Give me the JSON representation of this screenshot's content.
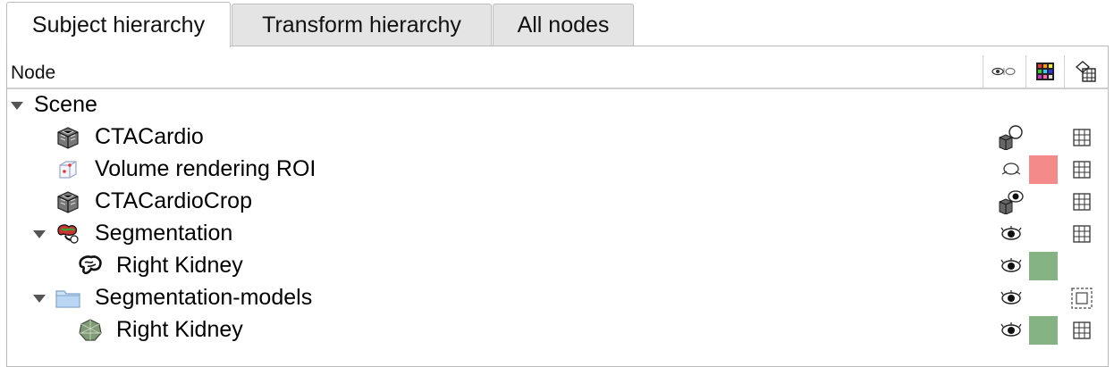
{
  "tabs": [
    {
      "label": "Subject hierarchy",
      "active": true
    },
    {
      "label": "Transform hierarchy",
      "active": false
    },
    {
      "label": "All nodes",
      "active": false
    }
  ],
  "tree": {
    "header": {
      "node": "Node",
      "columns": [
        {
          "icon": "visibility-eye-icon"
        },
        {
          "icon": "color-grid-icon"
        },
        {
          "icon": "transform-column-icon"
        }
      ]
    },
    "rows": [
      {
        "label": "Scene",
        "icon": "none",
        "expanded": true,
        "visibility": "none",
        "color": null,
        "transform": "none"
      },
      {
        "label": "CTACardio",
        "icon": "volume-cube-icon",
        "visibility": "volume-hidden-icon",
        "color": null,
        "transform": "transform-grid-icon"
      },
      {
        "label": "Volume rendering ROI",
        "icon": "roi-box-icon",
        "visibility": "eye-closed-icon",
        "color": "#f48a8a",
        "transform": "transform-grid-icon"
      },
      {
        "label": "CTACardioCrop",
        "icon": "volume-cube-icon",
        "visibility": "volume-visible-icon",
        "color": null,
        "transform": "transform-grid-icon"
      },
      {
        "label": "Segmentation",
        "icon": "segmentation-icon",
        "expanded": true,
        "visibility": "eye-open-icon",
        "color": null,
        "transform": "transform-grid-icon"
      },
      {
        "label": "Right Kidney",
        "icon": "segment-icon",
        "visibility": "eye-open-icon",
        "color": "#86b383",
        "transform": "none"
      },
      {
        "label": "Segmentation-models",
        "icon": "folder-icon",
        "expanded": true,
        "visibility": "eye-open-icon",
        "color": null,
        "transform": "transform-dashed-icon"
      },
      {
        "label": "Right Kidney",
        "icon": "model-icon",
        "visibility": "eye-open-icon",
        "color": "#86b383",
        "transform": "transform-grid-icon"
      }
    ]
  }
}
